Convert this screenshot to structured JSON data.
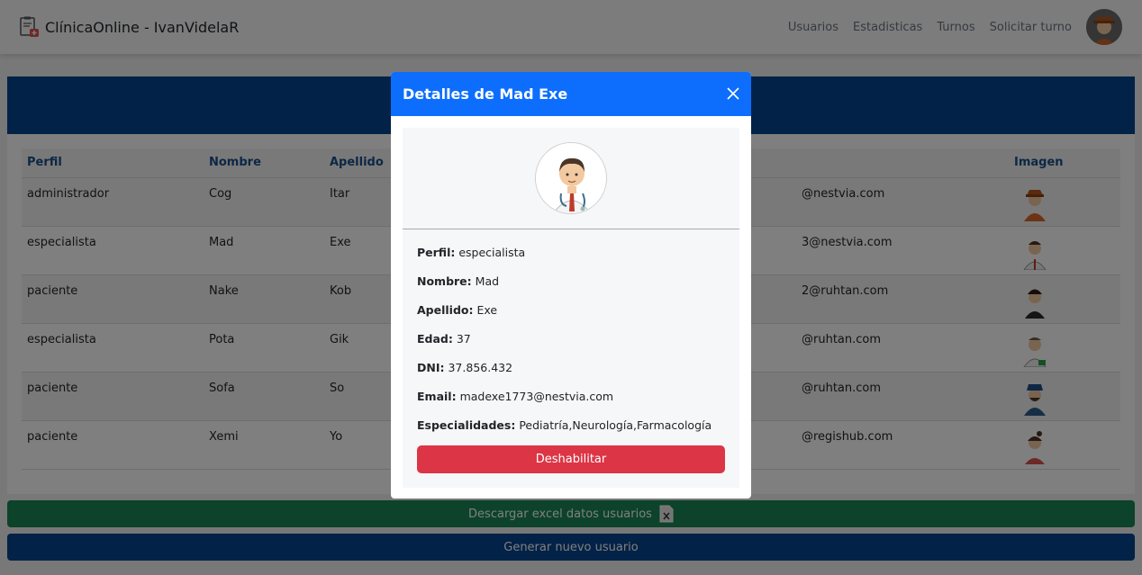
{
  "navbar": {
    "brand": "ClínicaOnline - IvanVidelaR",
    "links": [
      "Usuarios",
      "Estadisticas",
      "Turnos",
      "Solicitar turno"
    ]
  },
  "table": {
    "headers": [
      "Perfil",
      "Nombre",
      "Apellido",
      "",
      "Imagen"
    ],
    "rows": [
      {
        "perfil": "administrador",
        "nombre": "Cog",
        "apellido": "Itar",
        "email": "@nestvia.com"
      },
      {
        "perfil": "especialista",
        "nombre": "Mad",
        "apellido": "Exe",
        "email": "3@nestvia.com"
      },
      {
        "perfil": "paciente",
        "nombre": "Nake",
        "apellido": "Kob",
        "email": "2@ruhtan.com"
      },
      {
        "perfil": "especialista",
        "nombre": "Pota",
        "apellido": "Gik",
        "email": "@ruhtan.com"
      },
      {
        "perfil": "paciente",
        "nombre": "Sofa",
        "apellido": "So",
        "email": "@ruhtan.com"
      },
      {
        "perfil": "paciente",
        "nombre": "Xemi",
        "apellido": "Yo",
        "email": "@regishub.com"
      }
    ]
  },
  "buttons": {
    "excel": "Descargar excel datos usuarios",
    "generate": "Generar nuevo usuario"
  },
  "modal": {
    "title": "Detalles de Mad Exe",
    "details": [
      {
        "label": "Perfil:",
        "value": "especialista"
      },
      {
        "label": "Nombre:",
        "value": "Mad"
      },
      {
        "label": "Apellido:",
        "value": "Exe"
      },
      {
        "label": "Edad:",
        "value": "37"
      },
      {
        "label": "DNI:",
        "value": "37.856.432"
      },
      {
        "label": "Email:",
        "value": "madexe1773@nestvia.com"
      },
      {
        "label": "Especialidades:",
        "value": "Pediatría,Neurología,Farmacología"
      }
    ],
    "disable_button": "Deshabilitar"
  },
  "colors": {
    "primary_dark": "#05458f",
    "modal_header": "#0d6efd",
    "excel_green": "#198754",
    "danger": "#dc3545"
  }
}
